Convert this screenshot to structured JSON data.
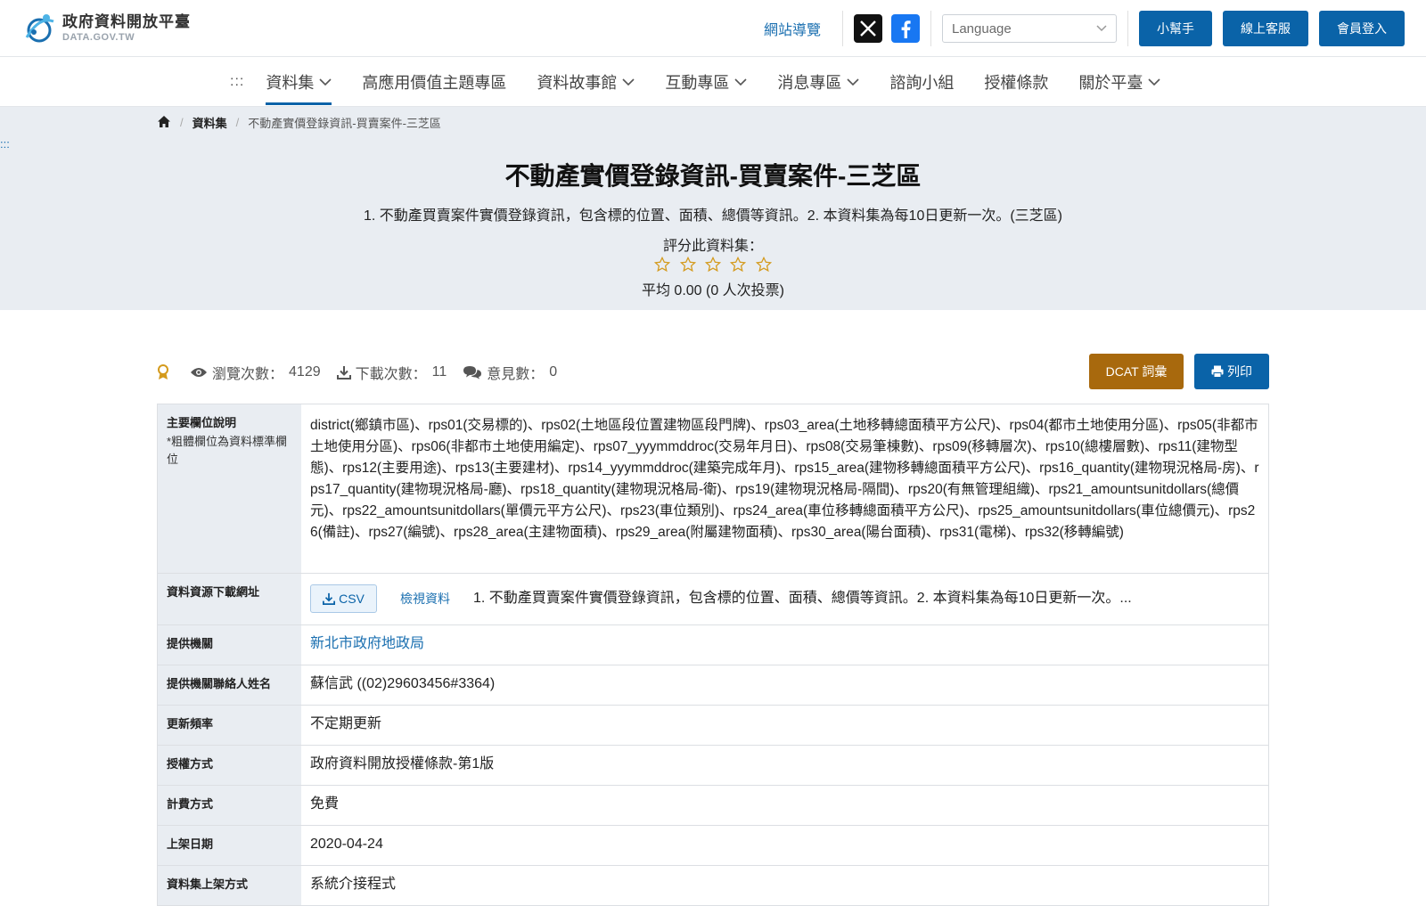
{
  "header": {
    "logo_cn": "政府資料開放平臺",
    "logo_en": "DATA.GOV.TW",
    "sitemap": "網站導覽",
    "language_placeholder": "Language",
    "helper": "小幫手",
    "service": "線上客服",
    "login": "會員登入",
    "colors": {
      "primary": "#0a63a8",
      "accent": "#a8690d",
      "x": "#111111",
      "facebook": "#1877f2"
    }
  },
  "nav": {
    "dots": ":::",
    "items": [
      {
        "label": "資料集",
        "dropdown": true,
        "active": true
      },
      {
        "label": "高應用價值主題專區",
        "dropdown": false
      },
      {
        "label": "資料故事館",
        "dropdown": true
      },
      {
        "label": "互動專區",
        "dropdown": true
      },
      {
        "label": "消息專區",
        "dropdown": true
      },
      {
        "label": "諮詢小組",
        "dropdown": false
      },
      {
        "label": "授權條款",
        "dropdown": false
      },
      {
        "label": "關於平臺",
        "dropdown": true
      }
    ]
  },
  "breadcrumb": {
    "home_icon": "home-icon",
    "items": [
      "資料集",
      "不動產實價登錄資訊-買賣案件-三芝區"
    ],
    "side_dots": ":::"
  },
  "hero": {
    "title": "不動產實價登錄資訊-買賣案件-三芝區",
    "description": "1. 不動產買賣案件實價登錄資訊，包含標的位置、面積、總價等資訊。2. 本資料集為每10日更新一次。(三芝區)",
    "rate_label": "評分此資料集：",
    "stars": 5,
    "rating_value": 0,
    "rate_avg": "平均 0.00 (0 人次投票)"
  },
  "stats": {
    "views_label": "瀏覽次數：",
    "views": "4129",
    "downloads_label": "下載次數：",
    "downloads": "11",
    "comments_label": "意見數：",
    "comments": "0"
  },
  "actions": {
    "dcat": "DCAT 詞彙",
    "print": "列印"
  },
  "table": {
    "fields_label": "主要欄位說明",
    "fields_note": "*粗體欄位為資料標準欄位",
    "fields": "district(鄉鎮市區)、rps01(交易標的)、rps02(土地區段位置建物區段門牌)、rps03_area(土地移轉總面積平方公尺)、rps04(都市土地使用分區)、rps05(非都市土地使用分區)、rps06(非都市土地使用編定)、rps07_yyymmddroc(交易年月日)、rps08(交易筆棟數)、rps09(移轉層次)、rps10(總樓層數)、rps11(建物型態)、rps12(主要用途)、rps13(主要建材)、rps14_yyymmddroc(建築完成年月)、rps15_area(建物移轉總面積平方公尺)、rps16_quantity(建物現況格局-房)、rps17_quantity(建物現況格局-廳)、rps18_quantity(建物現況格局-衛)、rps19(建物現況格局-隔間)、rps20(有無管理組織)、rps21_amountsunitdollars(總價元)、rps22_amountsunitdollars(單價元平方公尺)、rps23(車位類別)、rps24_area(車位移轉總面積平方公尺)、rps25_amountsunitdollars(車位總價元)、rps26(備註)、rps27(編號)、rps28_area(主建物面積)、rps29_area(附屬建物面積)、rps30_area(陽台面積)、rps31(電梯)、rps32(移轉編號)",
    "download_label": "資料資源下載網址",
    "csv": "CSV",
    "view_data": "檢視資料",
    "download_desc": "1. 不動產買賣案件實價登錄資訊，包含標的位置、面積、總價等資訊。2. 本資料集為每10日更新一次。...",
    "rows": [
      {
        "label": "提供機關",
        "value": "新北市政府地政局",
        "link": true
      },
      {
        "label": "提供機關聯絡人姓名",
        "value": "蘇信武 ((02)29603456#3364)"
      },
      {
        "label": "更新頻率",
        "value": "不定期更新"
      },
      {
        "label": "授權方式",
        "value": "政府資料開放授權條款-第1版"
      },
      {
        "label": "計費方式",
        "value": "免費"
      },
      {
        "label": "上架日期",
        "value": "2020-04-24"
      },
      {
        "label": "資料集上架方式",
        "value": "系統介接程式"
      }
    ]
  }
}
